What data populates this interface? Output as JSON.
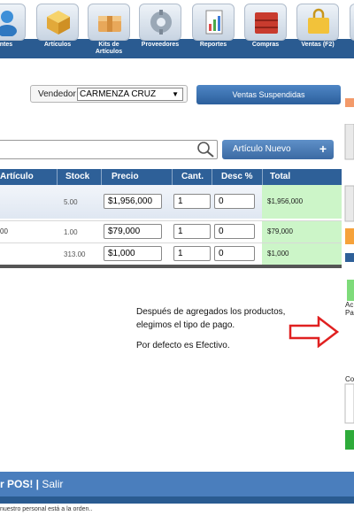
{
  "nav": {
    "items": [
      {
        "label": "entes",
        "icon": "clients-icon"
      },
      {
        "label": "Artículos",
        "icon": "articles-box-icon"
      },
      {
        "label": "Kits de Artículos",
        "icon": "kits-icon"
      },
      {
        "label": "Proveedores",
        "icon": "suppliers-icon"
      },
      {
        "label": "Reportes",
        "icon": "reports-icon"
      },
      {
        "label": "Compras",
        "icon": "purchases-icon"
      },
      {
        "label": "Ventas (F2)",
        "icon": "sales-icon"
      }
    ]
  },
  "vendor": {
    "label": "Vendedor",
    "selected": "CARMENZA CRUZ"
  },
  "suspended_button": "Ventas Suspendidas",
  "search": {
    "value": "",
    "new_item_button": "Artículo Nuevo",
    "new_item_plus": "+"
  },
  "table": {
    "headers": {
      "article": "Artículo",
      "stock": "Stock",
      "price": "Precio",
      "qty": "Cant.",
      "discount": "Desc %",
      "total": "Total"
    },
    "rows": [
      {
        "article": "",
        "stock": "5.00",
        "price": "$1,956,000",
        "qty": "1",
        "discount": "0",
        "total": "$1,956,000"
      },
      {
        "article": "00",
        "stock": "1.00",
        "price": "$79,000",
        "qty": "1",
        "discount": "0",
        "total": "$79,000"
      },
      {
        "article": "",
        "stock": "313.00",
        "price": "$1,000",
        "qty": "1",
        "discount": "0",
        "total": "$1,000"
      }
    ]
  },
  "note": {
    "line1": "Después de agregados los productos,",
    "line2": "elegimos el tipo de pago.",
    "line3": "Por defecto es Efectivo."
  },
  "right_panel": {
    "text_a": "Ac",
    "text_p": "Pa",
    "text_c": "Co"
  },
  "footer": {
    "brand": "r POS!",
    "separator": " | ",
    "logout": "Salir",
    "small_text": "nuestro personal está a la orden.."
  },
  "colors": {
    "nav_band": "#2a5b91",
    "table_header": "#2e6098",
    "total_cell": "#ccf5c8",
    "arrow": "#e02020",
    "button": "#3b6aa3"
  }
}
